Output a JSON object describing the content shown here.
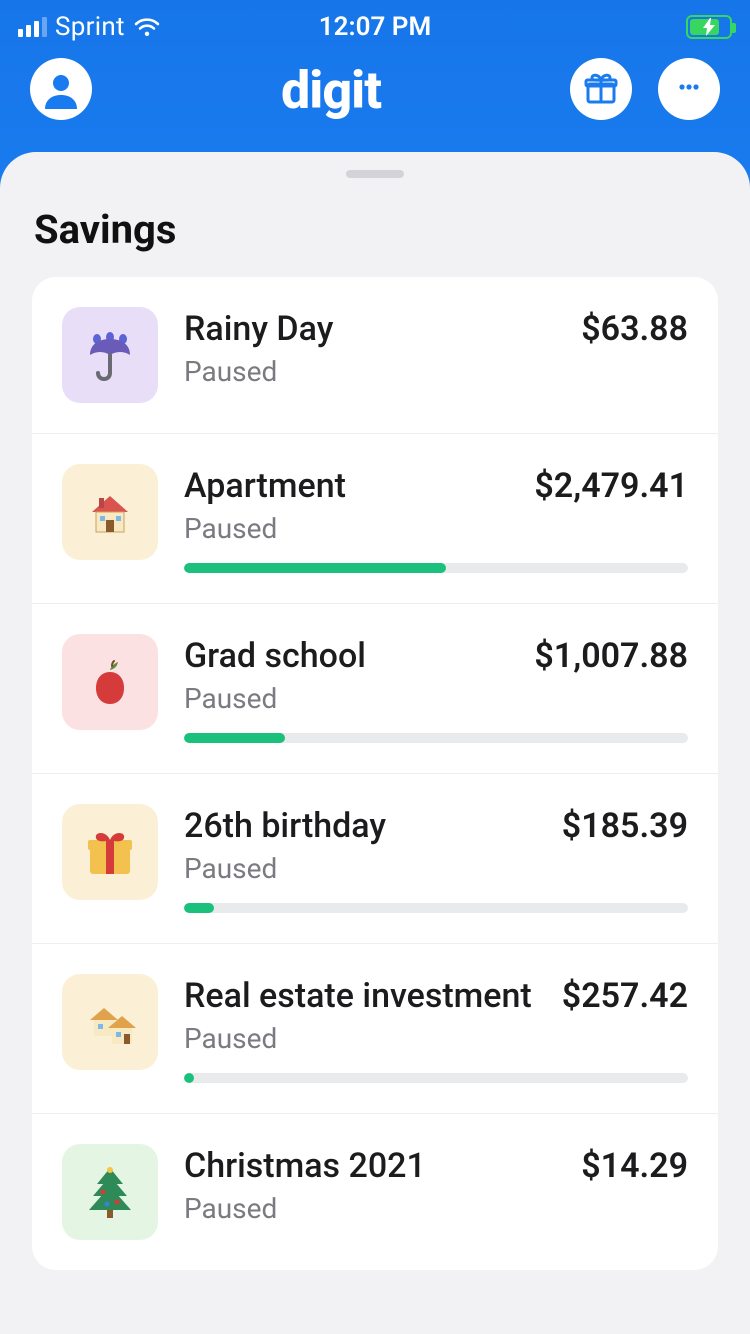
{
  "status_bar": {
    "carrier": "Sprint",
    "time": "12:07 PM"
  },
  "header": {
    "app_name": "digit"
  },
  "section": {
    "title": "Savings"
  },
  "goals": [
    {
      "name": "Rainy Day",
      "status": "Paused",
      "amount": "$63.88",
      "icon": "umbrella",
      "bg": "bg-lavender",
      "progress": null
    },
    {
      "name": "Apartment",
      "status": "Paused",
      "amount": "$2,479.41",
      "icon": "house",
      "bg": "bg-cream",
      "progress": 52
    },
    {
      "name": "Grad school",
      "status": "Paused",
      "amount": "$1,007.88",
      "icon": "apple",
      "bg": "bg-pink",
      "progress": 20
    },
    {
      "name": "26th birthday",
      "status": "Paused",
      "amount": "$185.39",
      "icon": "gift",
      "bg": "bg-cream",
      "progress": 6
    },
    {
      "name": "Real estate investment",
      "status": "Paused",
      "amount": "$257.42",
      "icon": "houses",
      "bg": "bg-cream",
      "progress": 2
    },
    {
      "name": "Christmas 2021",
      "status": "Paused",
      "amount": "$14.29",
      "icon": "tree",
      "bg": "bg-mint",
      "progress": null
    }
  ]
}
